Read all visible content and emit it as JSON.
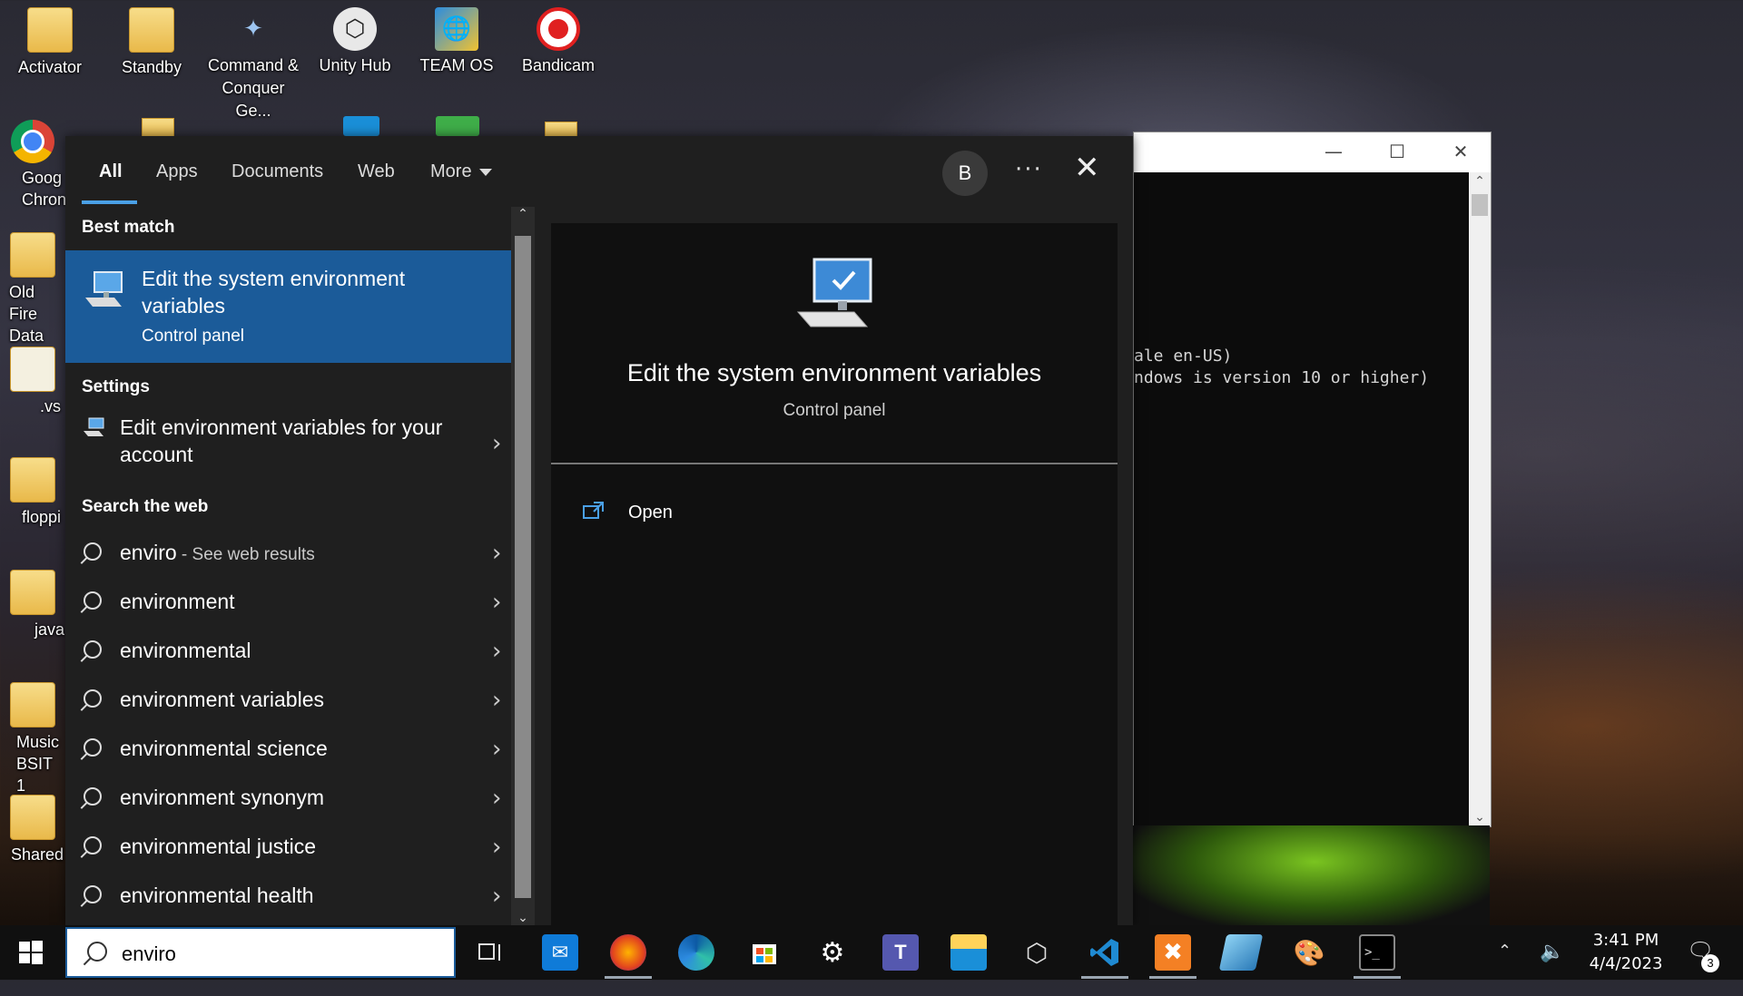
{
  "desktop": {
    "icons": [
      {
        "label": "Activator"
      },
      {
        "label": "Standby"
      },
      {
        "label": "Command & Conquer Ge..."
      },
      {
        "label": "Unity Hub"
      },
      {
        "label": "TEAM OS"
      },
      {
        "label": "Bandicam"
      },
      {
        "label": "Goog Chron"
      },
      {
        "label": "Old Fire Data"
      },
      {
        "label": ".vs"
      },
      {
        "label": "floppi"
      },
      {
        "label": "java"
      },
      {
        "label": "Music BSIT 1"
      },
      {
        "label": "Shared"
      }
    ]
  },
  "console": {
    "lines": [
      "ale en-US)",
      "ndows is version 10 or higher)"
    ]
  },
  "search": {
    "tabs": [
      {
        "label": "All"
      },
      {
        "label": "Apps"
      },
      {
        "label": "Documents"
      },
      {
        "label": "Web"
      },
      {
        "label": "More"
      }
    ],
    "avatar_letter": "B",
    "more_options": "···",
    "close_glyph": "✕",
    "sections": {
      "best_match": "Best match",
      "settings": "Settings",
      "search_web": "Search the web"
    },
    "best_match": {
      "title": "Edit the system environment variables",
      "subtitle": "Control panel"
    },
    "settings_item": {
      "label": "Edit environment variables for your account"
    },
    "web_results": [
      {
        "term": "enviro",
        "suffix": " - See web results"
      },
      {
        "term": "environment",
        "suffix": ""
      },
      {
        "term": "environmental",
        "suffix": ""
      },
      {
        "term": "environment variables",
        "suffix": ""
      },
      {
        "term": "environmental science",
        "suffix": ""
      },
      {
        "term": "environment synonym",
        "suffix": ""
      },
      {
        "term": "environmental justice",
        "suffix": ""
      },
      {
        "term": "environmental health",
        "suffix": ""
      }
    ],
    "preview": {
      "title": "Edit the system environment variables",
      "subtitle": "Control panel",
      "open_label": "Open"
    }
  },
  "taskbar": {
    "search_value": "enviro",
    "time": "3:41 PM",
    "date": "4/4/2023",
    "notification_count": "3",
    "accent": "#1b5b99"
  }
}
